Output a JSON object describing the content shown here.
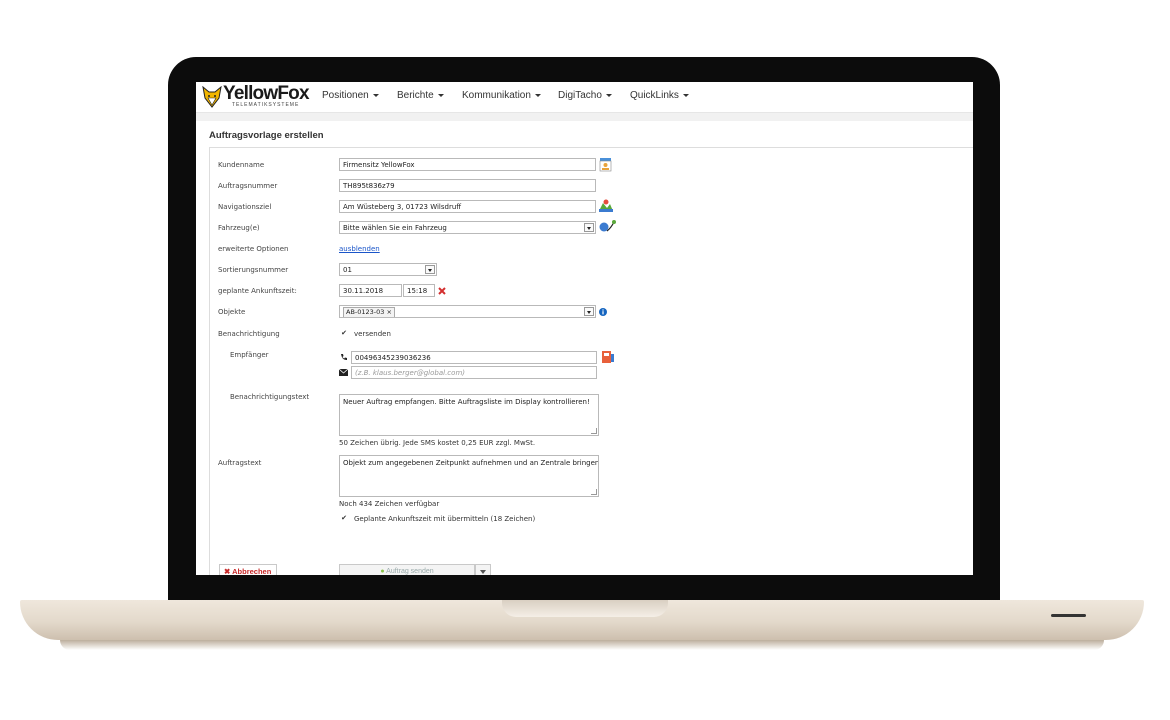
{
  "brand": {
    "name": "YellowFox",
    "tagline": "TELEMATIKSYSTEME"
  },
  "nav": [
    {
      "label": "Positionen"
    },
    {
      "label": "Berichte"
    },
    {
      "label": "Kommunikation"
    },
    {
      "label": "DigiTacho"
    },
    {
      "label": "QuickLinks"
    }
  ],
  "page": {
    "title": "Auftragsvorlage erstellen"
  },
  "form": {
    "kundenname": {
      "label": "Kundenname",
      "value": "Firmensitz YellowFox"
    },
    "auftragsnummer": {
      "label": "Auftragsnummer",
      "value": "TH895t836z79"
    },
    "navigationsziel": {
      "label": "Navigationsziel",
      "value": "Am Wüsteberg 3, 01723 Wilsdruff"
    },
    "fahrzeug": {
      "label": "Fahrzeug(e)",
      "value": "Bitte wählen Sie ein Fahrzeug"
    },
    "optionen": {
      "label": "erweiterte Optionen",
      "link": "ausblenden"
    },
    "sortierung": {
      "label": "Sortierungsnummer",
      "value": "01"
    },
    "ankunft": {
      "label": "geplante Ankunftszeit:",
      "date": "30.11.2018",
      "time": "15:18"
    },
    "objekte": {
      "label": "Objekte",
      "tag": "AB-0123-03"
    },
    "benachrichtigung": {
      "label": "Benachrichtigung",
      "checkbox_label": "versenden",
      "checked": true
    },
    "empfaenger": {
      "label": "Empfänger",
      "phone": "00496345239036236",
      "email_placeholder": "(z.B. klaus.berger@global.com)"
    },
    "benachrichtigungstext": {
      "label": "Benachrichtigungstext",
      "value": "Neuer Auftrag empfangen. Bitte Auftragsliste im Display kontrollieren!",
      "hint": "50 Zeichen übrig. Jede SMS kostet 0,25 EUR zzgl. MwSt."
    },
    "auftragstext": {
      "label": "Auftragstext",
      "value": "Objekt zum angegebenen Zeitpunkt aufnehmen und an Zentrale bringen",
      "hint": "Noch 434 Zeichen verfügbar",
      "checkbox_label": "Geplante Ankunftszeit mit übermitteln (18 Zeichen)",
      "checked": true
    }
  },
  "buttons": {
    "cancel": "Abbrechen",
    "send": "Auftrag senden"
  },
  "colors": {
    "accent_yellow": "#f2b600",
    "cancel_red": "#c62828",
    "link_blue": "#1a55c9",
    "info_blue": "#1565c0"
  }
}
